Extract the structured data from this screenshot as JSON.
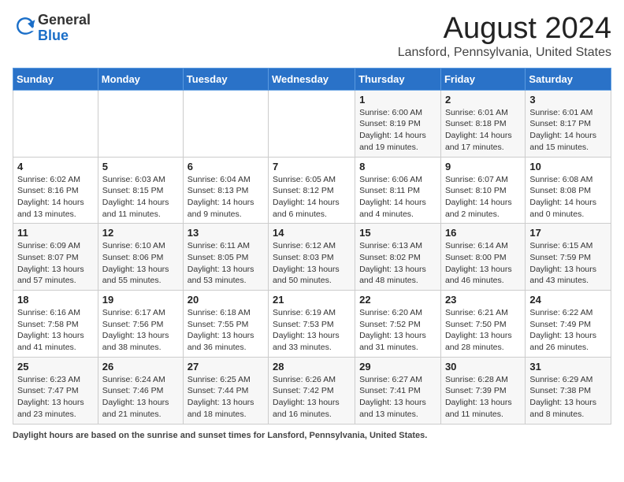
{
  "header": {
    "logo_general": "General",
    "logo_blue": "Blue",
    "month_title": "August 2024",
    "location": "Lansford, Pennsylvania, United States"
  },
  "weekdays": [
    "Sunday",
    "Monday",
    "Tuesday",
    "Wednesday",
    "Thursday",
    "Friday",
    "Saturday"
  ],
  "weeks": [
    [
      {
        "day": "",
        "sunrise": "",
        "sunset": "",
        "daylight": ""
      },
      {
        "day": "",
        "sunrise": "",
        "sunset": "",
        "daylight": ""
      },
      {
        "day": "",
        "sunrise": "",
        "sunset": "",
        "daylight": ""
      },
      {
        "day": "",
        "sunrise": "",
        "sunset": "",
        "daylight": ""
      },
      {
        "day": "1",
        "sunrise": "6:00 AM",
        "sunset": "8:19 PM",
        "daylight": "14 hours and 19 minutes."
      },
      {
        "day": "2",
        "sunrise": "6:01 AM",
        "sunset": "8:18 PM",
        "daylight": "14 hours and 17 minutes."
      },
      {
        "day": "3",
        "sunrise": "6:01 AM",
        "sunset": "8:17 PM",
        "daylight": "14 hours and 15 minutes."
      }
    ],
    [
      {
        "day": "4",
        "sunrise": "6:02 AM",
        "sunset": "8:16 PM",
        "daylight": "14 hours and 13 minutes."
      },
      {
        "day": "5",
        "sunrise": "6:03 AM",
        "sunset": "8:15 PM",
        "daylight": "14 hours and 11 minutes."
      },
      {
        "day": "6",
        "sunrise": "6:04 AM",
        "sunset": "8:13 PM",
        "daylight": "14 hours and 9 minutes."
      },
      {
        "day": "7",
        "sunrise": "6:05 AM",
        "sunset": "8:12 PM",
        "daylight": "14 hours and 6 minutes."
      },
      {
        "day": "8",
        "sunrise": "6:06 AM",
        "sunset": "8:11 PM",
        "daylight": "14 hours and 4 minutes."
      },
      {
        "day": "9",
        "sunrise": "6:07 AM",
        "sunset": "8:10 PM",
        "daylight": "14 hours and 2 minutes."
      },
      {
        "day": "10",
        "sunrise": "6:08 AM",
        "sunset": "8:08 PM",
        "daylight": "14 hours and 0 minutes."
      }
    ],
    [
      {
        "day": "11",
        "sunrise": "6:09 AM",
        "sunset": "8:07 PM",
        "daylight": "13 hours and 57 minutes."
      },
      {
        "day": "12",
        "sunrise": "6:10 AM",
        "sunset": "8:06 PM",
        "daylight": "13 hours and 55 minutes."
      },
      {
        "day": "13",
        "sunrise": "6:11 AM",
        "sunset": "8:05 PM",
        "daylight": "13 hours and 53 minutes."
      },
      {
        "day": "14",
        "sunrise": "6:12 AM",
        "sunset": "8:03 PM",
        "daylight": "13 hours and 50 minutes."
      },
      {
        "day": "15",
        "sunrise": "6:13 AM",
        "sunset": "8:02 PM",
        "daylight": "13 hours and 48 minutes."
      },
      {
        "day": "16",
        "sunrise": "6:14 AM",
        "sunset": "8:00 PM",
        "daylight": "13 hours and 46 minutes."
      },
      {
        "day": "17",
        "sunrise": "6:15 AM",
        "sunset": "7:59 PM",
        "daylight": "13 hours and 43 minutes."
      }
    ],
    [
      {
        "day": "18",
        "sunrise": "6:16 AM",
        "sunset": "7:58 PM",
        "daylight": "13 hours and 41 minutes."
      },
      {
        "day": "19",
        "sunrise": "6:17 AM",
        "sunset": "7:56 PM",
        "daylight": "13 hours and 38 minutes."
      },
      {
        "day": "20",
        "sunrise": "6:18 AM",
        "sunset": "7:55 PM",
        "daylight": "13 hours and 36 minutes."
      },
      {
        "day": "21",
        "sunrise": "6:19 AM",
        "sunset": "7:53 PM",
        "daylight": "13 hours and 33 minutes."
      },
      {
        "day": "22",
        "sunrise": "6:20 AM",
        "sunset": "7:52 PM",
        "daylight": "13 hours and 31 minutes."
      },
      {
        "day": "23",
        "sunrise": "6:21 AM",
        "sunset": "7:50 PM",
        "daylight": "13 hours and 28 minutes."
      },
      {
        "day": "24",
        "sunrise": "6:22 AM",
        "sunset": "7:49 PM",
        "daylight": "13 hours and 26 minutes."
      }
    ],
    [
      {
        "day": "25",
        "sunrise": "6:23 AM",
        "sunset": "7:47 PM",
        "daylight": "13 hours and 23 minutes."
      },
      {
        "day": "26",
        "sunrise": "6:24 AM",
        "sunset": "7:46 PM",
        "daylight": "13 hours and 21 minutes."
      },
      {
        "day": "27",
        "sunrise": "6:25 AM",
        "sunset": "7:44 PM",
        "daylight": "13 hours and 18 minutes."
      },
      {
        "day": "28",
        "sunrise": "6:26 AM",
        "sunset": "7:42 PM",
        "daylight": "13 hours and 16 minutes."
      },
      {
        "day": "29",
        "sunrise": "6:27 AM",
        "sunset": "7:41 PM",
        "daylight": "13 hours and 13 minutes."
      },
      {
        "day": "30",
        "sunrise": "6:28 AM",
        "sunset": "7:39 PM",
        "daylight": "13 hours and 11 minutes."
      },
      {
        "day": "31",
        "sunrise": "6:29 AM",
        "sunset": "7:38 PM",
        "daylight": "13 hours and 8 minutes."
      }
    ]
  ],
  "footer": {
    "label": "Daylight hours",
    "description": " are based on the sunrise and sunset times for Lansford, Pennsylvania, United States."
  }
}
